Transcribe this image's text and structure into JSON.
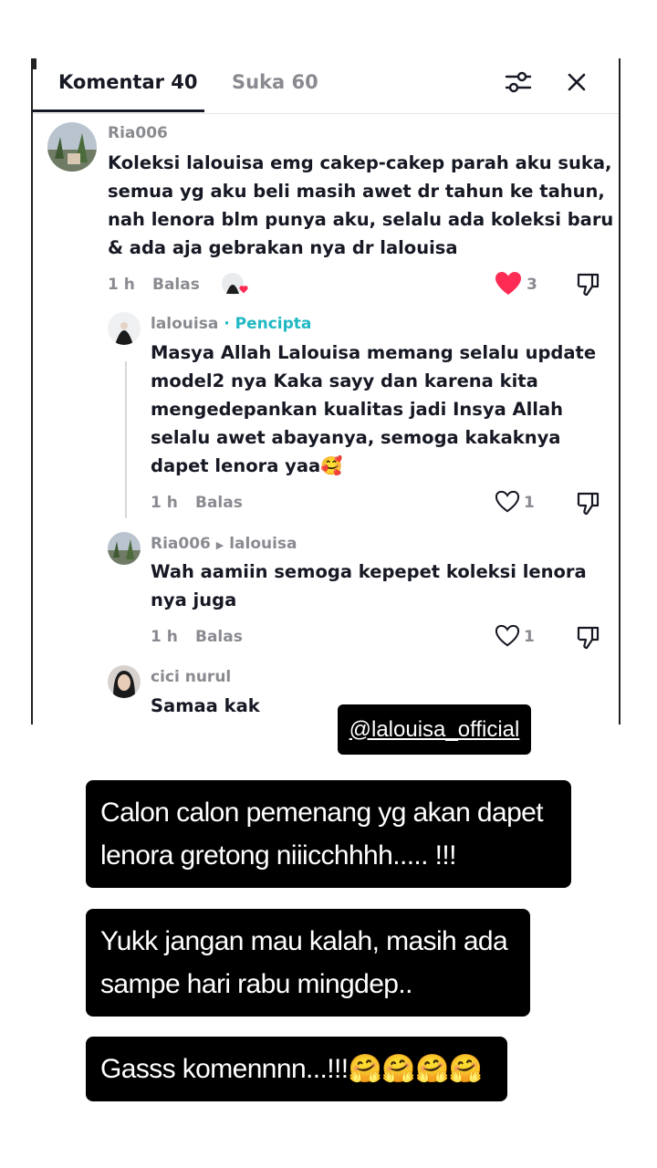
{
  "tabs": {
    "comments": "Komentar 40",
    "likes": "Suka 60"
  },
  "comments": [
    {
      "user": "Ria006",
      "text": "Koleksi lalouisa emg cakep-cakep parah aku suka, semua yg aku beli masih awet dr tahun ke tahun, nah lenora blm punya aku, selalu ada koleksi baru & ada aja gebrakan nya dr lalouisa",
      "time": "1 h",
      "reply": "Balas",
      "likes": "3",
      "liked": true
    },
    {
      "user": "lalouisa",
      "badge": "· Pencipta",
      "text": "Masya Allah Lalouisa memang selalu update model2 nya Kaka sayy dan karena kita mengedepankan kualitas jadi Insya Allah selalu awet abayanya, semoga kakaknya dapet lenora yaa🥰",
      "time": "1 h",
      "reply": "Balas",
      "likes": "1"
    },
    {
      "user": "Ria006",
      "reply_to": "lalouisa",
      "text": "Wah aamiin semoga kepepet koleksi lenora nya juga",
      "time": "1 h",
      "reply": "Balas",
      "likes": "1"
    },
    {
      "user": "cici nurul",
      "text": "Samaa kak"
    }
  ],
  "story": {
    "handle": "@lalouisa_official",
    "texts": [
      [
        "Calon calon pemenang yg akan dapet",
        "lenora gretong niiicchhhh..... !!!"
      ],
      [
        "Yukk jangan mau kalah, masih ada",
        "sampe hari rabu mingdep.."
      ],
      [
        "Gasss komennnn...!!!🤗🤗🤗🤗"
      ]
    ]
  },
  "colors": {
    "like_red": "#fe2c55",
    "creator_teal": "#20b8c4",
    "muted": "#8a8b91"
  }
}
